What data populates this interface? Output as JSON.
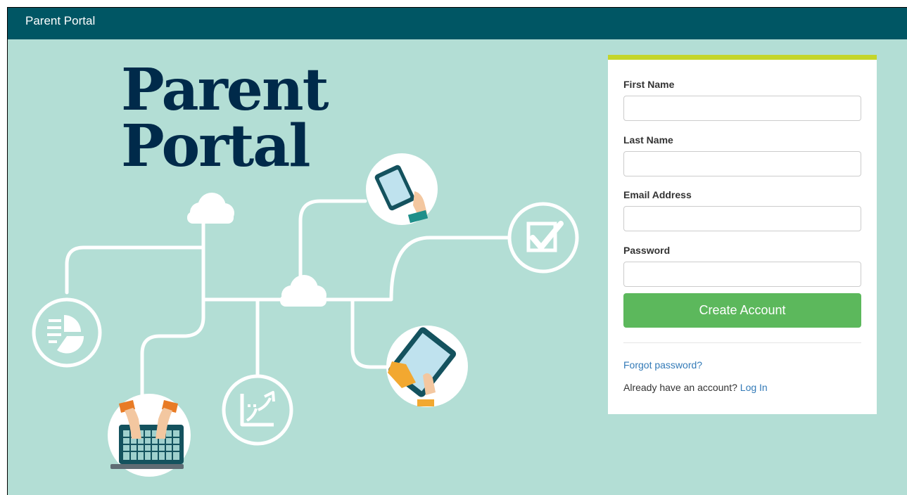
{
  "header": {
    "title": "Parent Portal"
  },
  "hero": {
    "title_line1": "Parent",
    "title_line2": "Portal"
  },
  "form": {
    "first_name_label": "First Name",
    "first_name_value": "",
    "last_name_label": "Last Name",
    "last_name_value": "",
    "email_label": "Email Address",
    "email_value": "",
    "password_label": "Password",
    "password_value": "",
    "submit_label": "Create Account",
    "forgot_link": "Forgot password?",
    "login_prompt": "Already have an account?",
    "login_link": "Log In"
  },
  "colors": {
    "header_bg": "#005664",
    "hero_bg": "#b3ded5",
    "hero_title": "#002a4a",
    "accent_bar": "#c4d52a",
    "button": "#5cb85c",
    "link": "#337ab7"
  },
  "illustration_icons": [
    "cloud-icon",
    "pie-chart-icon",
    "laptop-icon",
    "growth-chart-icon",
    "smartphone-icon",
    "tablet-icon",
    "checkbox-icon"
  ]
}
